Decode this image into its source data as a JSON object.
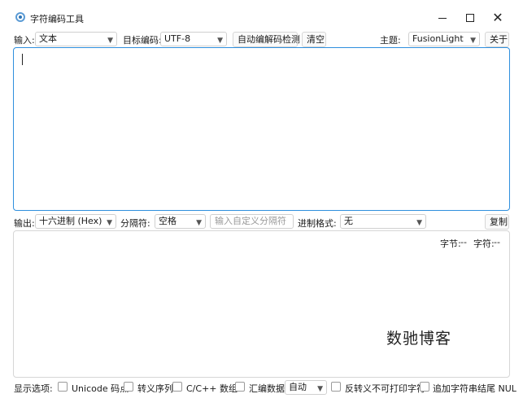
{
  "window": {
    "title": "字符编码工具",
    "close_glyph": "✕"
  },
  "toolbar": {
    "input_label": "输入:",
    "input_mode": "文本",
    "target_encoding_label": "目标编码:",
    "target_encoding": "UTF-8",
    "auto_detect_button": "自动编解码检测",
    "clear_button": "清空",
    "theme_label": "主题:",
    "theme": "FusionLight",
    "about_button": "关于"
  },
  "input_area": {
    "value": ""
  },
  "output_bar": {
    "output_label": "输出:",
    "output_format": "十六进制 (Hex)",
    "separator_label": "分隔符:",
    "separator": "空格",
    "custom_separator_placeholder": "输入自定义分隔符",
    "radix_format_label": "进制格式:",
    "radix_format": "无",
    "copy_button": "复制"
  },
  "output_area": {
    "bytes_label": "字节:",
    "bytes_value": "--",
    "chars_label": "字符:",
    "chars_value": "--"
  },
  "watermark": "数驰博客",
  "display_options": {
    "label": "显示选项:",
    "unicode_codepoints": {
      "label": "Unicode 码点",
      "checked": false
    },
    "escape_sequence": {
      "label": "转义序列",
      "checked": false
    },
    "c_array": {
      "label": "C/C++ 数组",
      "checked": false
    },
    "asm_data": {
      "label": "汇编数据",
      "checked": false
    },
    "asm_mode": "自动",
    "escape_nonprintable": {
      "label": "反转义不可打印字符",
      "checked": false
    },
    "append_nul": {
      "label": "追加字符串结尾 NUL",
      "checked": false
    }
  },
  "icons": {
    "app": "app-icon",
    "dropdown": "chevron-down-icon"
  },
  "colors": {
    "focus_border": "#2f8fde",
    "border": "#d6d6d6"
  }
}
